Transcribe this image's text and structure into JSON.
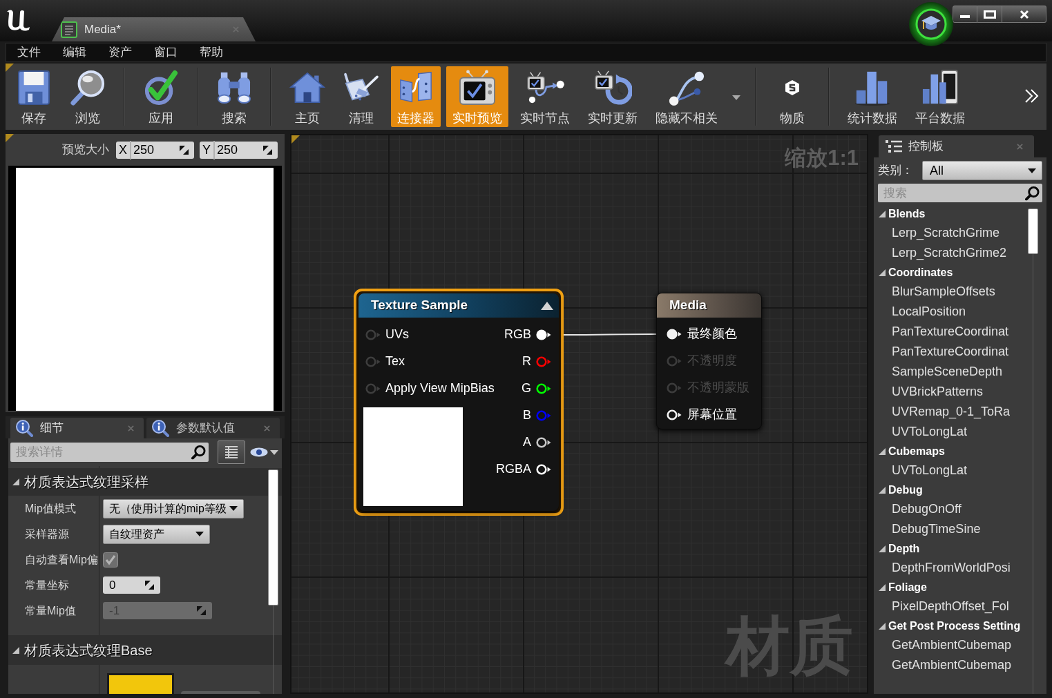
{
  "title_bar": {
    "tabs": [
      {
        "label": "Media*",
        "selected": true
      }
    ]
  },
  "menu": [
    {
      "label": "文件"
    },
    {
      "label": "编辑"
    },
    {
      "label": "资产"
    },
    {
      "label": "窗口"
    },
    {
      "label": "帮助"
    }
  ],
  "toolbar": {
    "items": [
      {
        "kind": "button",
        "label": "保存",
        "on": false
      },
      {
        "kind": "button",
        "label": "浏览",
        "on": false
      },
      {
        "kind": "separator"
      },
      {
        "kind": "button",
        "label": "应用",
        "on": false
      },
      {
        "kind": "separator"
      },
      {
        "kind": "button",
        "label": "搜索",
        "on": false
      },
      {
        "kind": "separator"
      },
      {
        "kind": "button",
        "label": "主页",
        "on": false
      },
      {
        "kind": "button",
        "label": "清理",
        "on": false
      },
      {
        "kind": "button",
        "label": "连接器",
        "on": true
      },
      {
        "kind": "button",
        "label": "实时预览",
        "on": true
      },
      {
        "kind": "button",
        "label": "实时节点",
        "on": false
      },
      {
        "kind": "button",
        "label": "实时更新",
        "on": false
      },
      {
        "kind": "button",
        "label": "隐藏不相关",
        "on": false
      },
      {
        "kind": "dropdown"
      },
      {
        "kind": "separator"
      },
      {
        "kind": "button",
        "label": "物质",
        "on": false
      },
      {
        "kind": "separator"
      },
      {
        "kind": "button",
        "label": "统计数据",
        "on": false
      },
      {
        "kind": "button",
        "label": "平台数据",
        "on": false
      },
      {
        "kind": "overflow"
      }
    ]
  },
  "preview": {
    "size_label": "预览大小",
    "fields": [
      {
        "label": "X",
        "value": "250"
      },
      {
        "label": "Y",
        "value": "250"
      }
    ]
  },
  "details": {
    "tabs": [
      {
        "label": "细节",
        "selected": true
      },
      {
        "label": "参数默认值",
        "selected": false
      }
    ],
    "search": {
      "placeholder": "搜索详情"
    },
    "sections": [
      {
        "title": "材质表达式纹理采样",
        "expanded": true,
        "properties": [
          {
            "kind": "dropdown",
            "label": "Mip值模式",
            "value": "无（使用计算的mip等级",
            "disabled": false
          },
          {
            "kind": "dropdown",
            "label": "采样器源",
            "value": "自纹理资产",
            "disabled": false
          },
          {
            "kind": "checkbox",
            "label": "自动查看Mip偏",
            "checked": true,
            "disabled": false
          },
          {
            "kind": "number",
            "label": "常量坐标",
            "value": "0",
            "disabled": false
          },
          {
            "kind": "number",
            "label": "常量Mip值",
            "value": "-1",
            "disabled": true
          }
        ]
      },
      {
        "title": "材质表达式纹理Base",
        "expanded": true,
        "properties": [
          {
            "kind": "texture",
            "disabled": false
          }
        ]
      }
    ]
  },
  "graph": {
    "zoom_label": "缩放1:1",
    "type_label": "材质",
    "nodes": [
      {
        "kind": "expression",
        "title": "Texture Sample",
        "selected": true,
        "inputs": [
          {
            "label": "UVs",
            "connected": false,
            "disabled": false
          },
          {
            "label": "Tex",
            "connected": false,
            "disabled": false
          },
          {
            "label": "Apply View MipBias",
            "connected": false,
            "disabled": false
          }
        ],
        "outputs": [
          {
            "label": "RGB",
            "color": "#ffffff",
            "connected": true
          },
          {
            "label": "R",
            "color": "#ff0000",
            "connected": false
          },
          {
            "label": "G",
            "color": "#00ff00",
            "connected": false
          },
          {
            "label": "B",
            "color": "#0000ff",
            "connected": false
          },
          {
            "label": "A",
            "color": "#c8c8c8",
            "connected": false
          },
          {
            "label": "RGBA",
            "color": "#ffffff",
            "connected": false
          }
        ]
      },
      {
        "kind": "result",
        "title": "Media",
        "selected": false,
        "inputs": [
          {
            "label": "最终颜色",
            "connected": true,
            "disabled": false
          },
          {
            "label": "不透明度",
            "connected": false,
            "disabled": true
          },
          {
            "label": "不透明蒙版",
            "connected": false,
            "disabled": true
          },
          {
            "label": "屏幕位置",
            "connected": false,
            "disabled": false
          }
        ]
      }
    ]
  },
  "palette": {
    "tab": "控制板",
    "category_label": "类别：",
    "category_value": "All",
    "search": {
      "placeholder": "搜索"
    },
    "tree": [
      {
        "label": "Blends",
        "expanded": true,
        "children": [
          {
            "label": "Lerp_ScratchGrime"
          },
          {
            "label": "Lerp_ScratchGrime2"
          }
        ]
      },
      {
        "label": "Coordinates",
        "expanded": true,
        "children": [
          {
            "label": "BlurSampleOffsets"
          },
          {
            "label": "LocalPosition"
          },
          {
            "label": "PanTextureCoordinat"
          },
          {
            "label": "PanTextureCoordinat"
          },
          {
            "label": "SampleSceneDepth"
          },
          {
            "label": "UVBrickPatterns"
          },
          {
            "label": "UVRemap_0-1_ToRa"
          },
          {
            "label": "UVToLongLat"
          }
        ]
      },
      {
        "label": "Cubemaps",
        "expanded": true,
        "children": [
          {
            "label": "UVToLongLat"
          }
        ]
      },
      {
        "label": "Debug",
        "expanded": true,
        "children": [
          {
            "label": "DebugOnOff"
          },
          {
            "label": "DebugTimeSine"
          }
        ]
      },
      {
        "label": "Depth",
        "expanded": true,
        "children": [
          {
            "label": "DepthFromWorldPosi"
          }
        ]
      },
      {
        "label": "Foliage",
        "expanded": true,
        "children": [
          {
            "label": "PixelDepthOffset_Fol"
          }
        ]
      },
      {
        "label": "Get Post Process Setting",
        "expanded": true,
        "children": [
          {
            "label": "GetAmbientCubemap"
          },
          {
            "label": "GetAmbientCubemap"
          }
        ]
      }
    ]
  }
}
